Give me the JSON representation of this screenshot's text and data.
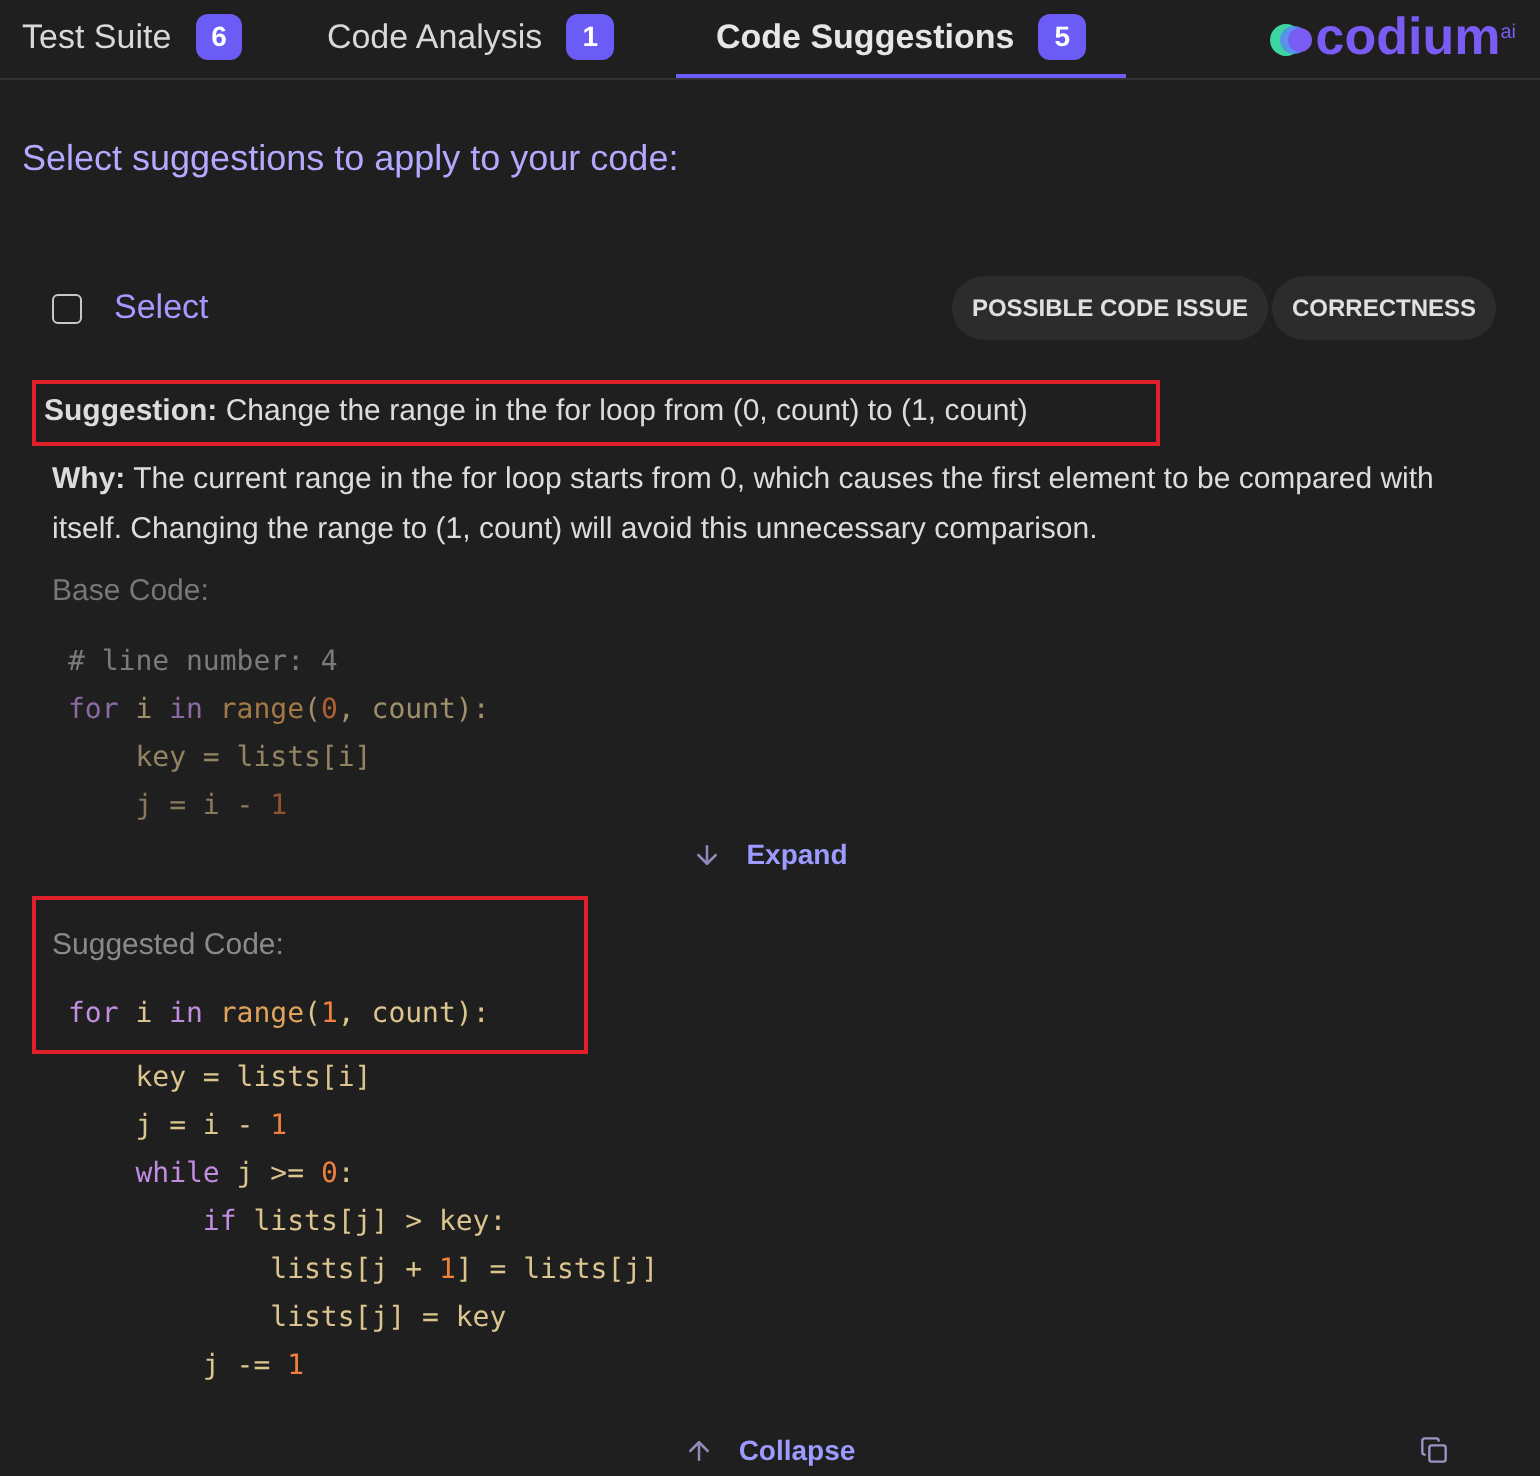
{
  "tabs": [
    {
      "label": "Test Suite",
      "count": "6",
      "selected": false
    },
    {
      "label": "Code Analysis",
      "count": "1",
      "selected": false
    },
    {
      "label": "Code Suggestions",
      "count": "5",
      "selected": true
    }
  ],
  "logo": {
    "name": "codium",
    "sup": "ai"
  },
  "heading": "Select suggestions to apply to your code:",
  "suggestion_card": {
    "select": {
      "label": "Select",
      "checked": false
    },
    "tags": [
      "POSSIBLE CODE ISSUE",
      "CORRECTNESS"
    ],
    "suggestion": {
      "text": "**Suggestion:** Change the range in the for loop from (0, count) to (1, count)",
      "highlighted": true
    },
    "why": "**Why:** The current range in the for loop starts from 0, which causes the first element to be compared with itself. Changing the range to (1, count) will avoid this unnecessary comparison.",
    "base_code": {
      "label": "Base Code:",
      "lines": [
        [
          {
            "kind": "comment",
            "text": "# line number: 4"
          }
        ],
        [
          {
            "kind": "keyword",
            "text": "for"
          },
          {
            "kind": "plain",
            "text": " i "
          },
          {
            "kind": "keyword",
            "text": "in"
          },
          {
            "kind": "func",
            "text": " range"
          },
          {
            "kind": "plain",
            "text": "("
          },
          {
            "kind": "number",
            "text": "0"
          },
          {
            "kind": "plain",
            "text": ", count):"
          }
        ],
        [
          {
            "kind": "plain",
            "text": "    key = lists[i]"
          }
        ],
        [
          {
            "kind": "plain",
            "text": "    j = i - "
          },
          {
            "kind": "number",
            "text": "1"
          }
        ]
      ],
      "toggle": "Expand"
    },
    "suggested_code": {
      "label": "Suggested Code:",
      "highlighted": true,
      "lines": [
        [
          {
            "kind": "keyword",
            "text": "for"
          },
          {
            "kind": "plain",
            "text": " i "
          },
          {
            "kind": "keyword",
            "text": "in"
          },
          {
            "kind": "func",
            "text": " range"
          },
          {
            "kind": "plain",
            "text": "("
          },
          {
            "kind": "number",
            "text": "1"
          },
          {
            "kind": "plain",
            "text": ", count):"
          }
        ],
        [
          {
            "kind": "plain",
            "text": "    key = lists[i]"
          }
        ],
        [
          {
            "kind": "plain",
            "text": "    j = i - "
          },
          {
            "kind": "number",
            "text": "1"
          }
        ],
        [
          {
            "kind": "keyword",
            "text": "    while"
          },
          {
            "kind": "plain",
            "text": " j >= "
          },
          {
            "kind": "number",
            "text": "0"
          },
          {
            "kind": "plain",
            "text": ":"
          }
        ],
        [
          {
            "kind": "keyword",
            "text": "        if"
          },
          {
            "kind": "plain",
            "text": " lists[j] > key:"
          }
        ],
        [
          {
            "kind": "plain",
            "text": "            lists[j + "
          },
          {
            "kind": "number",
            "text": "1"
          },
          {
            "kind": "plain",
            "text": "] = lists[j]"
          }
        ],
        [
          {
            "kind": "plain",
            "text": "            lists[j] = key"
          }
        ],
        [
          {
            "kind": "plain",
            "text": "        j -= "
          },
          {
            "kind": "number",
            "text": "1"
          }
        ]
      ],
      "toggle": "Collapse"
    }
  }
}
